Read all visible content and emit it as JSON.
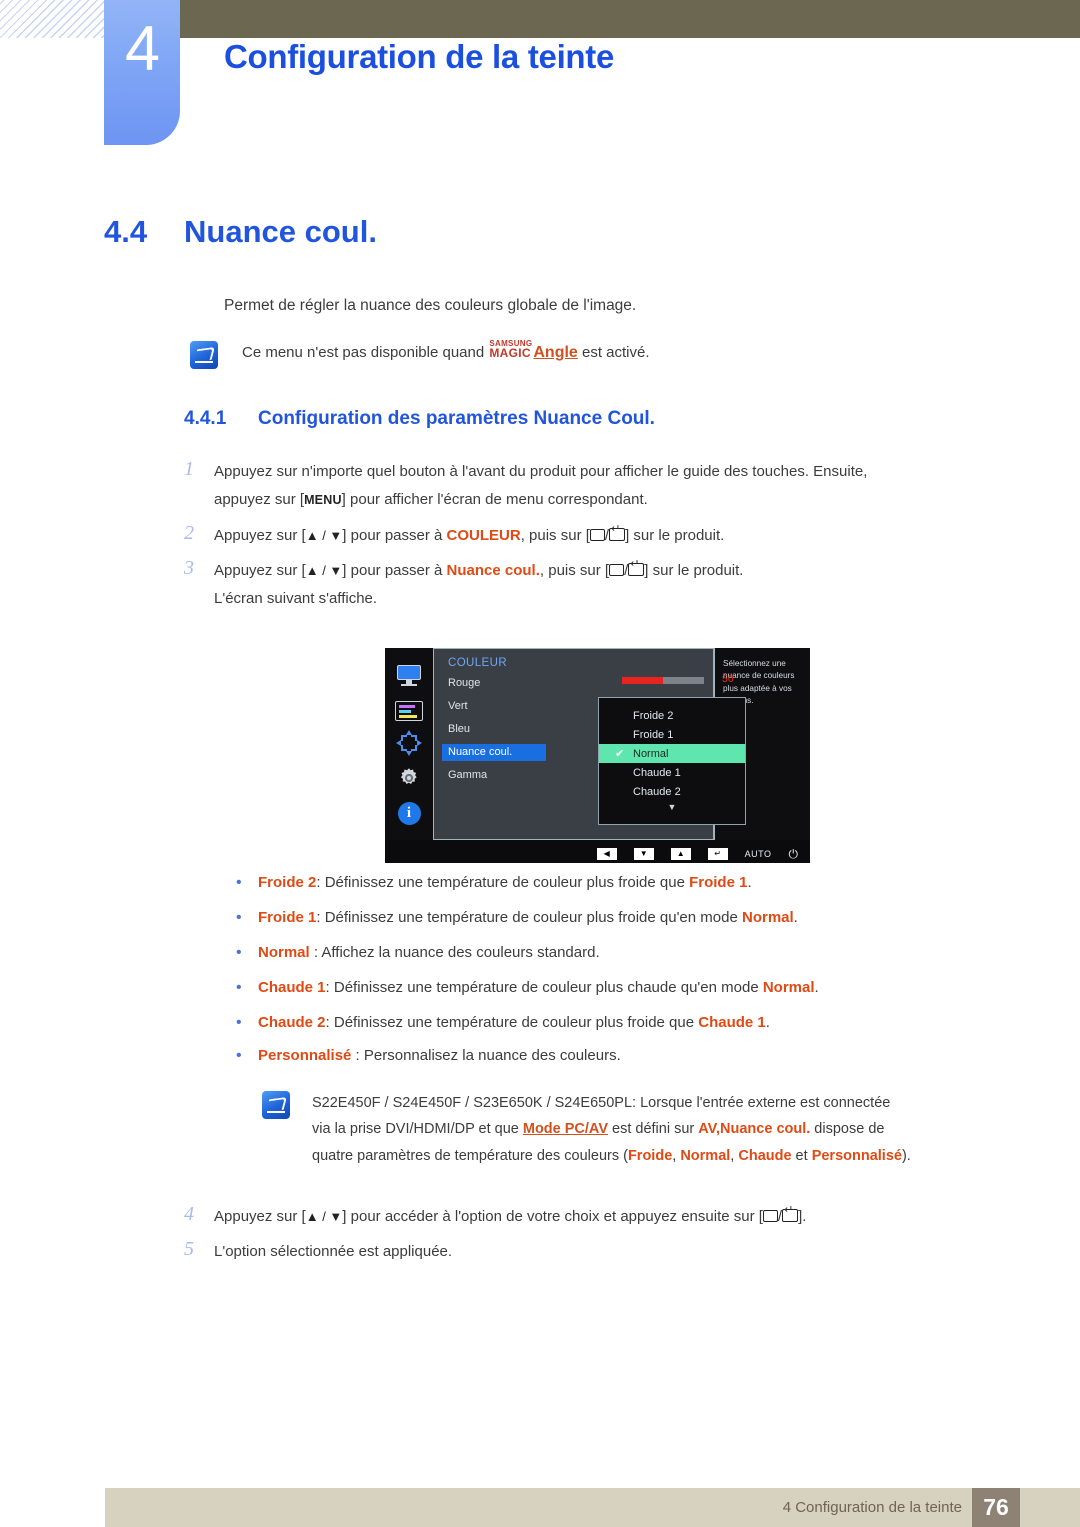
{
  "header": {
    "chapter_number": "4",
    "chapter_title": "Configuration de la teinte"
  },
  "section": {
    "number": "4.4",
    "title": "Nuance coul.",
    "intro": "Permet de régler la nuance des couleurs globale de l'image."
  },
  "note_top": {
    "prefix": "Ce menu n'est pas disponible quand ",
    "magic_top": "SAMSUNG",
    "magic_bottom": "MAGIC",
    "magic_suffix": "Angle",
    "suffix": " est activé."
  },
  "subsection": {
    "number": "4.4.1",
    "title": "Configuration des paramètres Nuance Coul."
  },
  "steps": {
    "s1_num": "1",
    "s1_a": "Appuyez sur n'importe quel bouton à l'avant du produit pour afficher le guide des touches. Ensuite,",
    "s1_b": "appuyez sur [",
    "s1_key": "MENU",
    "s1_c": "] pour afficher l'écran de menu correspondant.",
    "s2_num": "2",
    "s2_a": "Appuyez sur [",
    "s2_keys": "▲ / ▼",
    "s2_b": "] pour passer à ",
    "s2_target": "COULEUR",
    "s2_c": ", puis sur [",
    "s2_d": "] sur le produit.",
    "s3_num": "3",
    "s3_a": "Appuyez sur [",
    "s3_keys": "▲ / ▼",
    "s3_b": "] pour passer à ",
    "s3_target": "Nuance coul.",
    "s3_c": ", puis sur [",
    "s3_d": "] sur le produit.",
    "s3_note": "L'écran suivant s'affiche.",
    "s4_num": "4",
    "s4_a": "Appuyez sur [",
    "s4_keys": "▲ / ▼",
    "s4_b": "] pour accéder à l'option de votre choix et appuyez ensuite sur [",
    "s4_c": "].",
    "s5_num": "5",
    "s5_a": "L'option sélectionnée est appliquée."
  },
  "osd": {
    "menu_title": "COULEUR",
    "items": [
      {
        "label": "Rouge",
        "value": "50"
      },
      {
        "label": "Vert"
      },
      {
        "label": "Bleu"
      },
      {
        "label": "Nuance coul."
      },
      {
        "label": "Gamma"
      }
    ],
    "slider_value": "50",
    "dropdown": [
      "Froide 2",
      "Froide 1",
      "Normal",
      "Chaude 1",
      "Chaude 2"
    ],
    "dropdown_selected": "Normal",
    "more_indicator": "▼",
    "info_text": "Sélectionnez une nuance de couleurs plus adaptée à vos besoins.",
    "buttons": {
      "left": "◀",
      "down": "▼",
      "up": "▲",
      "enter": "↵",
      "auto": "AUTO",
      "power": "⏻"
    },
    "colors": {
      "highlight": "#1a6fe0",
      "selected_option": "#5fe6ae",
      "slider_fill": "#e8241f",
      "menu_title": "#6fa6f5"
    }
  },
  "bullets": [
    {
      "term": "Froide 2",
      "sep": ": ",
      "text_a": "Définissez une température de couleur plus froide que ",
      "term_b": "Froide 1",
      "text_b": "."
    },
    {
      "term": "Froide 1",
      "sep": ": ",
      "text_a": "Définissez une température de couleur plus froide qu'en mode ",
      "term_b": "Normal",
      "text_b": "."
    },
    {
      "term": "Normal",
      "sep": " : ",
      "text_a": "Affichez la nuance des couleurs standard.",
      "term_b": "",
      "text_b": ""
    },
    {
      "term": "Chaude 1",
      "sep": ": ",
      "text_a": "Définissez une température de couleur plus chaude qu'en mode ",
      "term_b": "Normal",
      "text_b": "."
    },
    {
      "term": "Chaude 2",
      "sep": ": ",
      "text_a": "Définissez une température de couleur plus froide que ",
      "term_b": "Chaude 1",
      "text_b": "."
    },
    {
      "term": "Personnalisé",
      "sep": " : ",
      "text_a": "Personnalisez la nuance des couleurs.",
      "term_b": "",
      "text_b": ""
    }
  ],
  "note_bottom": {
    "l1": "S22E450F / S24E450F / S23E650K / S24E650PL: Lorsque l'entrée externe est connectée",
    "l2_a": "via la prise DVI/HDMI/DP et que ",
    "l2_link": "Mode PC/AV",
    "l2_b": " est défini sur ",
    "l2_av": "AV,",
    "l2_nuance": "Nuance coul.",
    "l2_c": " dispose de",
    "l3_a": "quatre paramètres de température des couleurs (",
    "l3_t1": "Froide",
    "l3_s1": ", ",
    "l3_t2": "Normal",
    "l3_s2": ", ",
    "l3_t3": "Chaude",
    "l3_s3": " et ",
    "l3_t4": "Personnalisé",
    "l3_b": ")."
  },
  "footer": {
    "text": "4 Configuration de la teinte",
    "page": "76"
  }
}
